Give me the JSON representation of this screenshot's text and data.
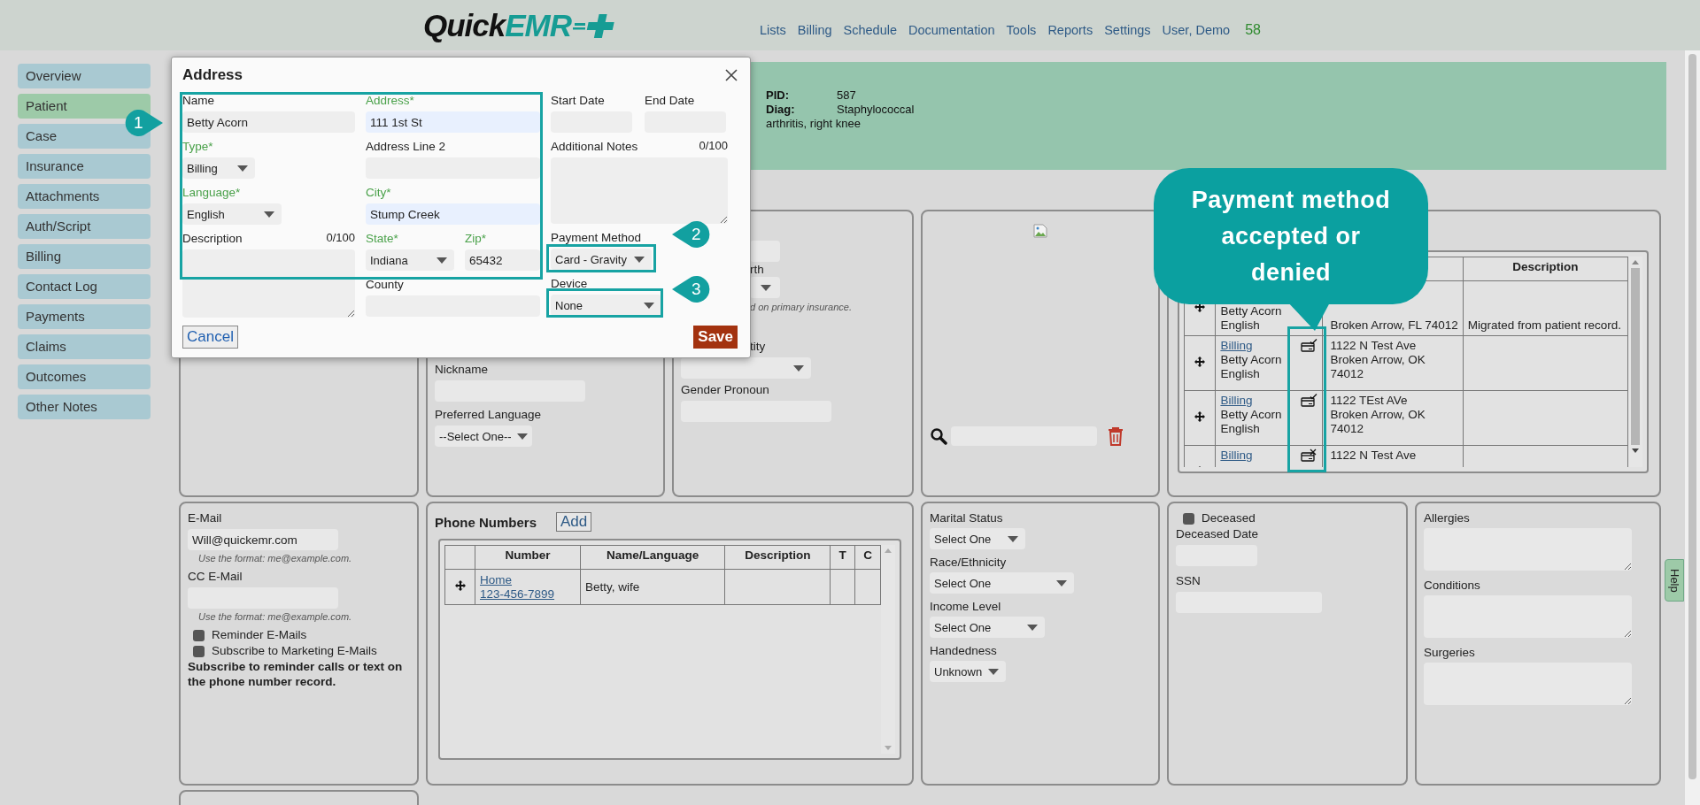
{
  "header": {
    "logo": {
      "first": "Quick",
      "second": "EMR"
    },
    "nav": [
      "Lists",
      "Billing",
      "Schedule",
      "Documentation",
      "Tools",
      "Reports",
      "Settings",
      "User, Demo"
    ],
    "count": "58"
  },
  "sidebar": {
    "items": [
      {
        "label": "Overview",
        "selected": false
      },
      {
        "label": "Patient",
        "selected": true
      },
      {
        "label": "Case",
        "selected": false
      },
      {
        "label": "Insurance",
        "selected": false
      },
      {
        "label": "Attachments",
        "selected": false
      },
      {
        "label": "Auth/Script",
        "selected": false
      },
      {
        "label": "Billing",
        "selected": false
      },
      {
        "label": "Contact Log",
        "selected": false
      },
      {
        "label": "Payments",
        "selected": false
      },
      {
        "label": "Claims",
        "selected": false
      },
      {
        "label": "Outcomes",
        "selected": false
      },
      {
        "label": "Other Notes",
        "selected": false
      }
    ]
  },
  "banner": {
    "fields": [
      {
        "label": "PID:",
        "value": "587"
      },
      {
        "label": "Diag:",
        "value": "Staphylococcal"
      }
    ],
    "continuation": "arthritis, right knee"
  },
  "address_dialog": {
    "title": "Address",
    "name": {
      "label": "Name",
      "required": false,
      "autofilled": false,
      "value": "Betty Acorn"
    },
    "type": {
      "label": "Type*",
      "required": true,
      "value": "Billing"
    },
    "language": {
      "label": "Language*",
      "required": true,
      "value": "English"
    },
    "description": {
      "label": "Description",
      "required": false,
      "counter": "0/100"
    },
    "address": {
      "label": "Address*",
      "required": true,
      "autofilled": true,
      "value": "111 1st St"
    },
    "address_line_2": {
      "label": "Address Line 2",
      "required": false,
      "autofilled": false
    },
    "city": {
      "label": "City*",
      "required": true,
      "autofilled": true,
      "value": "Stump Creek"
    },
    "state": {
      "label": "State*",
      "required": true,
      "value": "Indiana"
    },
    "zip": {
      "label": "Zip*",
      "required": true,
      "autofilled": false,
      "value": "65432"
    },
    "county": {
      "label": "County",
      "required": false,
      "autofilled": false
    },
    "start_date": {
      "label": "Start Date",
      "required": false,
      "autofilled": false
    },
    "end_date": {
      "label": "End Date",
      "required": false,
      "autofilled": false
    },
    "additional_notes": {
      "label": "Additional Notes",
      "required": false,
      "counter": "0/100"
    },
    "payment_method": {
      "label": "Payment Method",
      "required": false,
      "value": "Card - Gravity"
    },
    "device": {
      "label": "Device",
      "required": false,
      "value": "None"
    },
    "buttons": {
      "cancel": "Cancel",
      "save": "Save"
    }
  },
  "identity_panel": {
    "nickname": {
      "label": "Nickname"
    },
    "preferred_language": {
      "label": "Preferred Language",
      "value": "--Select One--"
    }
  },
  "demographics_panel": {
    "label_1": "rth",
    "note": "d on primary insurance.",
    "label_2": "tity",
    "gender_pronoun": {
      "label": "Gender Pronoun"
    }
  },
  "addresses": {
    "columns": [
      {
        "label": "Description"
      }
    ],
    "rows": [
      {
        "name_lines": [
          "Betty Acorn",
          "English"
        ],
        "address_lines": [
          "Broken Arrow, FL 74012"
        ],
        "description": "Migrated from patient record."
      },
      {
        "link": "Billing",
        "name_lines": [
          "Betty Acorn",
          "English"
        ],
        "payment_accepted": true,
        "address_lines": [
          "1122 N Test Ave",
          "Broken Arrow, OK",
          "74012"
        ]
      },
      {
        "link": "Billing",
        "name_lines": [
          "Betty Acorn",
          "English"
        ],
        "payment_accepted": true,
        "address_lines": [
          "1122 TEst AVe",
          "Broken Arrow, OK",
          "74012"
        ]
      },
      {
        "link": "Billing",
        "payment_accepted": false,
        "address_lines": [
          "1122 N Test Ave"
        ]
      }
    ]
  },
  "contact_panel": {
    "email": {
      "label": "E-Mail",
      "value": "Will@quickemr.com",
      "hint": "Use the format: me@example.com."
    },
    "cc_email": {
      "label": "CC E-Mail",
      "hint": "Use the format: me@example.com."
    },
    "options": [
      {
        "label": "Reminder E-Mails",
        "checked": false
      },
      {
        "label": "Subscribe to Marketing E-Mails",
        "checked": false
      }
    ],
    "note": "Subscribe to reminder calls or text on the phone number record."
  },
  "phone_numbers": {
    "title": "Phone Numbers",
    "add": "Add",
    "columns": [
      "Number",
      "Name/Language",
      "Description",
      "T",
      "C"
    ],
    "rows": [
      {
        "type": "Home",
        "number": "123-456-7899",
        "name": "Betty, wife"
      }
    ]
  },
  "social_panel": {
    "fields": [
      {
        "label": "Marital Status",
        "value": "Select One"
      },
      {
        "label": "Race/Ethnicity",
        "value": "Select One"
      },
      {
        "label": "Income Level",
        "value": "Select One"
      },
      {
        "label": "Handedness",
        "value": "Unknown"
      }
    ]
  },
  "deceased_panel": {
    "deceased": {
      "label": "Deceased",
      "checked": false
    },
    "date": {
      "label": "Deceased Date"
    },
    "ssn": {
      "label": "SSN"
    }
  },
  "history_panel": {
    "fields": [
      {
        "label": "Allergies"
      },
      {
        "label": "Conditions"
      },
      {
        "label": "Surgeries"
      }
    ]
  },
  "help_tab": "Help",
  "annotations": {
    "markers": [
      {
        "number": "1",
        "kind": "right"
      },
      {
        "number": "2",
        "kind": "left"
      },
      {
        "number": "3",
        "kind": "left"
      }
    ],
    "bubble": "Payment method accepted or denied"
  }
}
